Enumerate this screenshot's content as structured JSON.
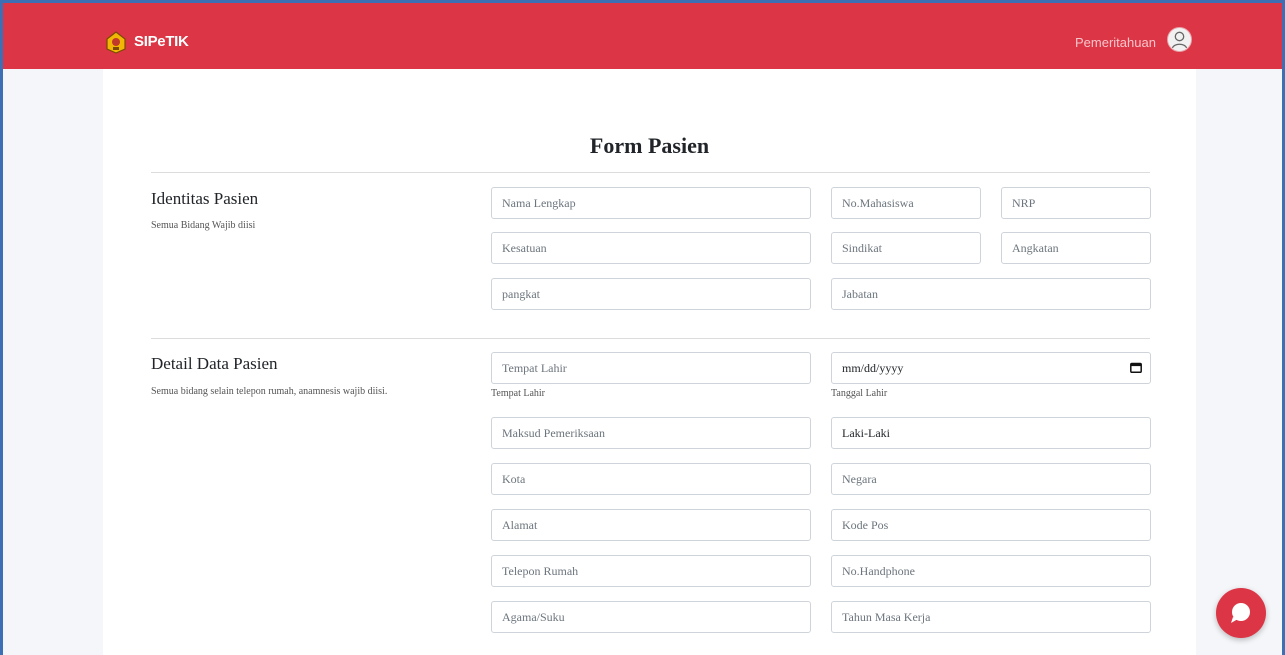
{
  "header": {
    "brand": "SIPeTIK",
    "notification_label": "Pemeritahuan",
    "icons": {
      "logo": "emblem-logo",
      "avatar": "user-avatar-icon",
      "chat": "chat-bubble-icon"
    },
    "colors": {
      "bar": "#dc3545",
      "frame": "#3c6fb3"
    }
  },
  "form": {
    "title": "Form Pasien",
    "identitas": {
      "title": "Identitas Pasien",
      "subtitle": "Semua Bidang Wajib diisi",
      "fields": {
        "nama_lengkap": "Nama Lengkap",
        "no_mahasiswa": "No.Mahasiswa",
        "nrp": "NRP",
        "kesatuan": "Kesatuan",
        "sindikat": "Sindikat",
        "angkatan": "Angkatan",
        "pangkat": "pangkat",
        "jabatan": "Jabatan"
      }
    },
    "detail": {
      "title": "Detail Data Pasien",
      "subtitle": "Semua bidang selain telepon rumah, anamnesis wajib diisi.",
      "fields": {
        "tempat_lahir": "Tempat Lahir",
        "tempat_lahir_help": "Tempat Lahir",
        "tanggal_lahir": "mm/dd/yyyy",
        "tanggal_lahir_help": "Tanggal Lahir",
        "maksud_pemeriksaan": "Maksud Pemeriksaan",
        "jenis_kelamin": "Laki-Laki",
        "kota": "Kota",
        "negara": "Negara",
        "alamat": "Alamat",
        "kode_pos": "Kode Pos",
        "telepon_rumah": "Telepon Rumah",
        "no_handphone": "No.Handphone",
        "agama_suku": "Agama/Suku",
        "tahun_masa_kerja": "Tahun Masa Kerja"
      }
    }
  }
}
